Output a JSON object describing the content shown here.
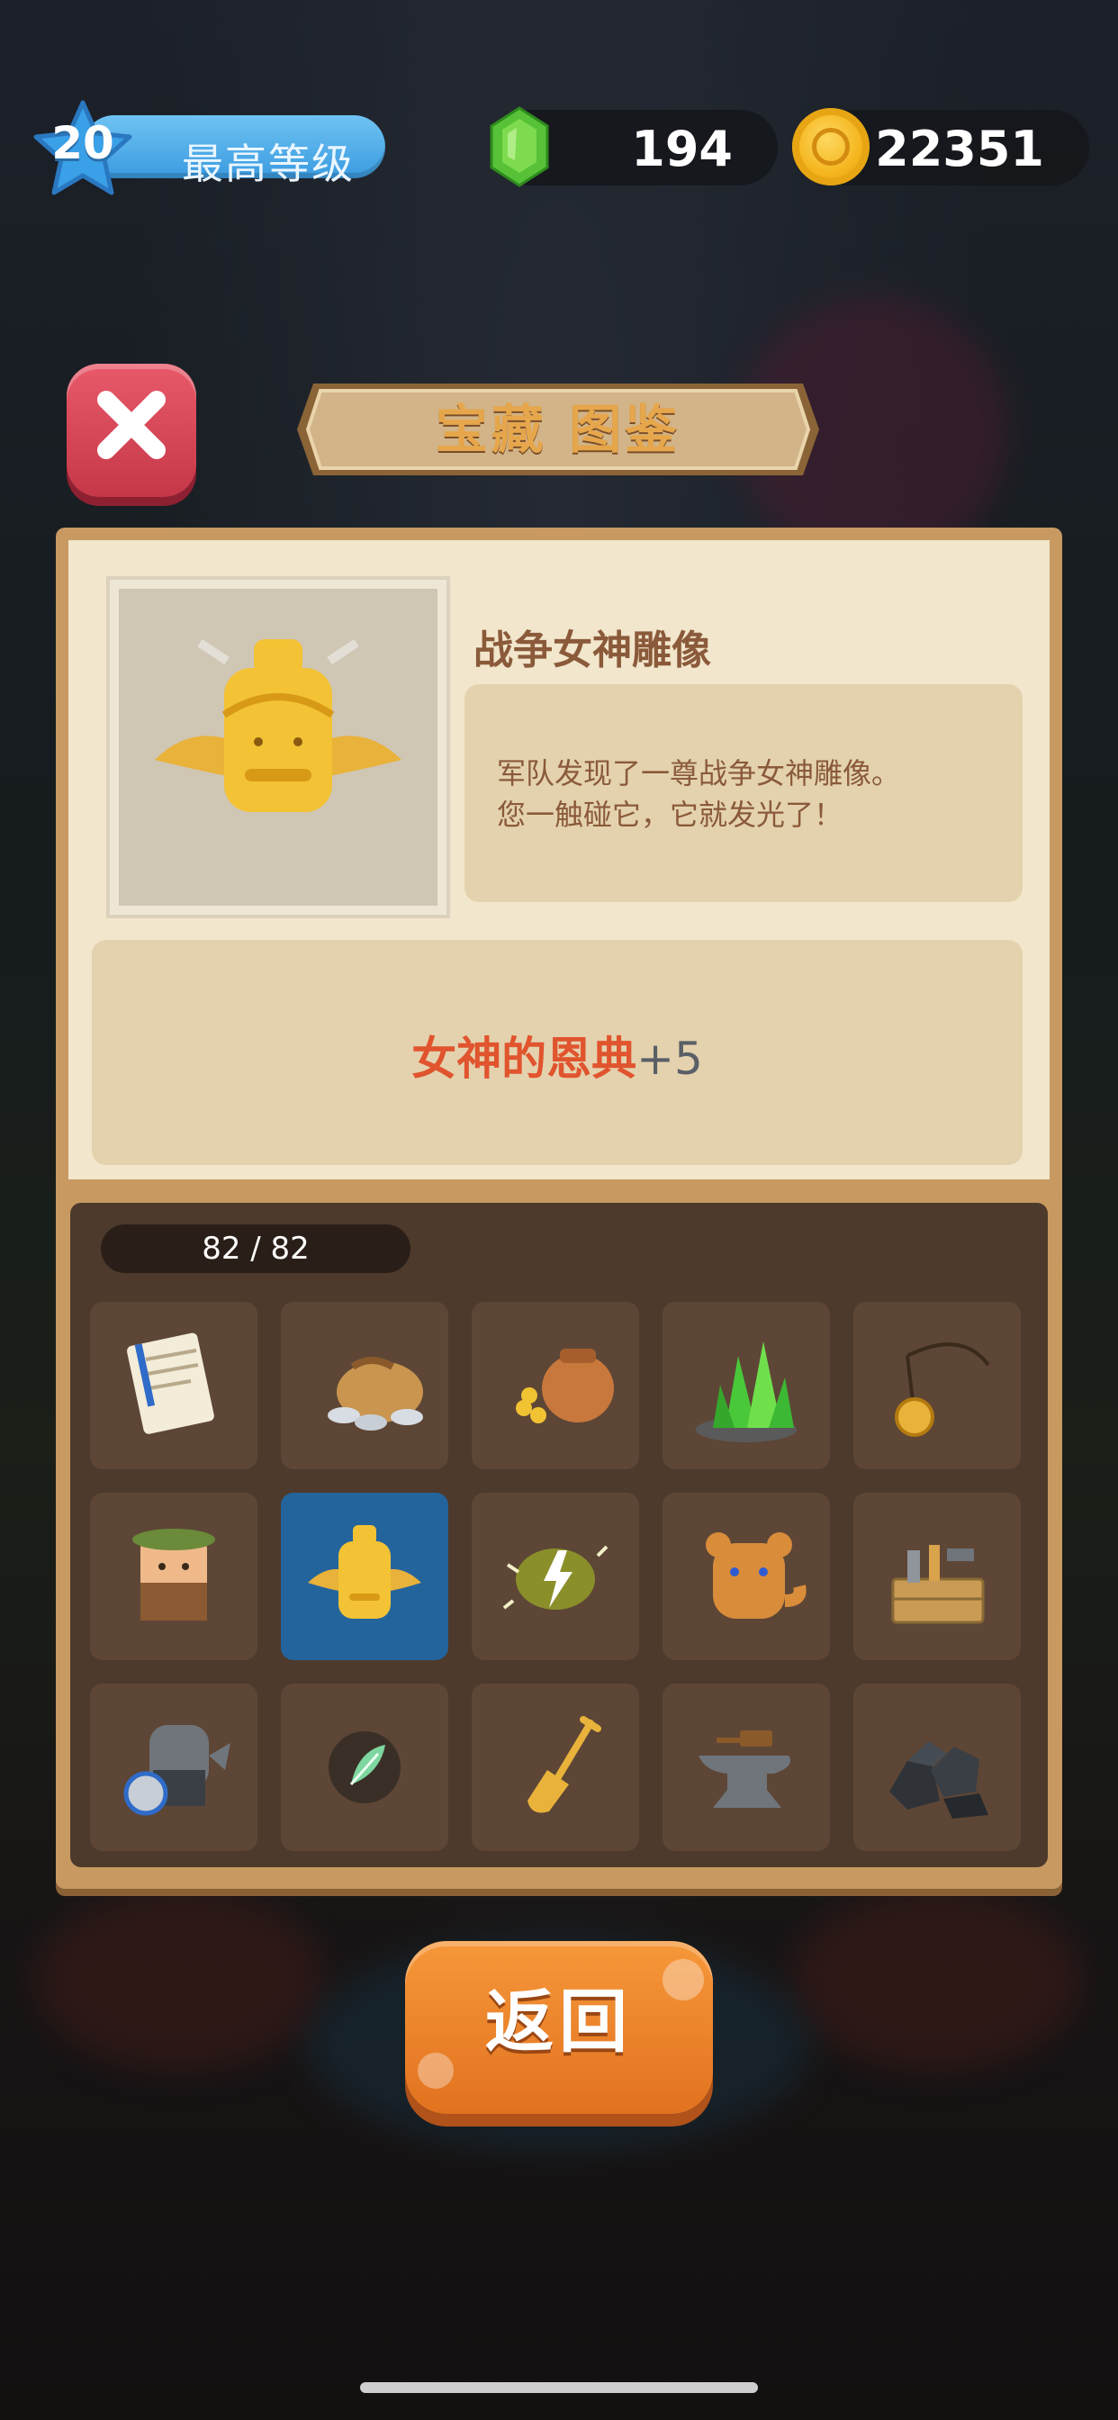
{
  "topbar": {
    "level": "20",
    "level_label": "最高等级",
    "gems": "194",
    "coins": "22351"
  },
  "dialog": {
    "title": "宝藏 图鉴",
    "item": {
      "name": "战争女神雕像",
      "description": "军队发现了一尊战争女神雕像。\n您一触碰它，它就发光了！",
      "bonus_name": "女神的恩典",
      "bonus_value": "+5"
    },
    "collection_counter": "82 / 82",
    "collection": [
      {
        "icon": "scroll-icon"
      },
      {
        "icon": "coin-sack-icon"
      },
      {
        "icon": "clay-pot-gold-icon"
      },
      {
        "icon": "green-crystal-icon"
      },
      {
        "icon": "amulet-icon"
      },
      {
        "icon": "explorer-block-icon"
      },
      {
        "icon": "goddess-statue-icon",
        "selected": true
      },
      {
        "icon": "lightning-stone-icon"
      },
      {
        "icon": "bear-icon"
      },
      {
        "icon": "toolbox-icon"
      },
      {
        "icon": "knight-helmet-shield-icon"
      },
      {
        "icon": "feather-icon"
      },
      {
        "icon": "shovel-icon"
      },
      {
        "icon": "anvil-icon"
      },
      {
        "icon": "coal-icon"
      }
    ],
    "back_label": "返回"
  }
}
